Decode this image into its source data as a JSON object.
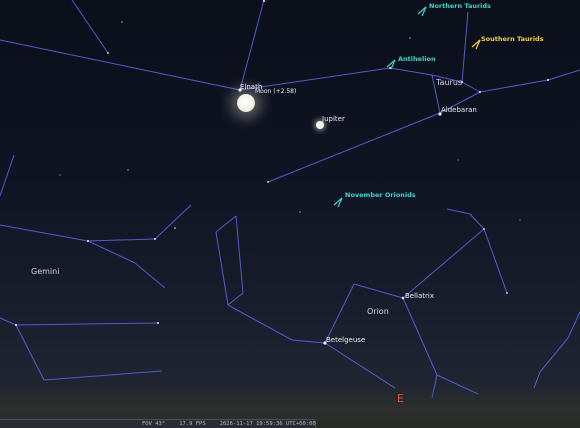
{
  "labels": {
    "constellations": {
      "gemini": "Gemini",
      "orion": "Orion",
      "taurus": "Taurus"
    },
    "stars": {
      "elnath": "Elnath",
      "aldebaran": "Aldebaran",
      "bellatrix": "Bellatrix",
      "betelgeuse": "Betelgeuse"
    },
    "planets": {
      "moon": "Moon (+2.58)",
      "jupiter": "Jupiter"
    },
    "meteor_showers": {
      "northern_taurids": "Northern Taurids",
      "southern_taurids": "Southern Taurids",
      "antihelion": "Antihelion",
      "november_orionids": "November Orionids"
    },
    "cardinal": {
      "east": "E"
    }
  },
  "status_bar": {
    "fov": "FOV 43°",
    "fps": "17.9 FPS",
    "datetime": "2026-11-17 19:59:36 UTC+00:00"
  },
  "colors": {
    "constellation_lines": "#5a62e0",
    "meteor_shower": "#39d5c8",
    "meteor_shower_south": "#f2d23a",
    "cardinal": "#e4572e"
  }
}
